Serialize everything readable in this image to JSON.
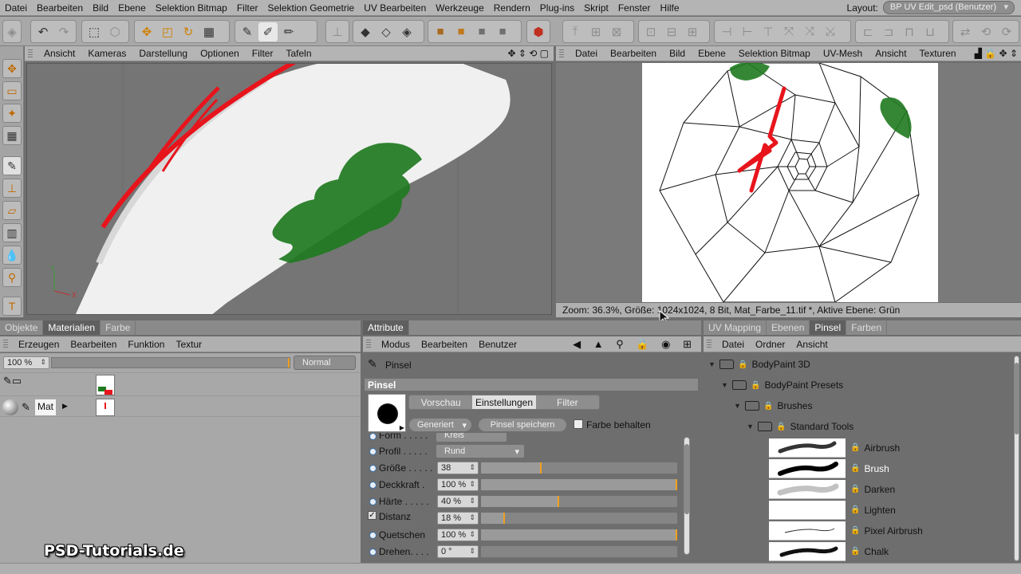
{
  "menubar": {
    "items": [
      "Datei",
      "Bearbeiten",
      "Bild",
      "Ebene",
      "Selektion Bitmap",
      "Filter",
      "Selektion Geometrie",
      "UV Bearbeiten",
      "Werkzeuge",
      "Rendern",
      "Plug-ins",
      "Skript",
      "Fenster",
      "Hilfe"
    ],
    "layout_label": "Layout:",
    "layout_value": "BP UV Edit_psd (Benutzer)"
  },
  "viewport": {
    "menu": [
      "Ansicht",
      "Kameras",
      "Darstellung",
      "Optionen",
      "Filter",
      "Tafeln"
    ]
  },
  "uv_editor": {
    "menu": [
      "Datei",
      "Bearbeiten",
      "Bild",
      "Ebene",
      "Selektion Bitmap",
      "UV-Mesh",
      "Ansicht",
      "Texturen"
    ],
    "status": "Zoom: 36.3%, Größe: 1024x1024, 8 Bit, Mat_Farbe_11.tif *, Aktive Ebene: Grün"
  },
  "materials_panel": {
    "tabs": [
      "Objekte",
      "Materialien",
      "Farbe"
    ],
    "active_tab": "Materialien",
    "menu": [
      "Erzeugen",
      "Bearbeiten",
      "Funktion",
      "Textur"
    ],
    "zoom_value": "100 %",
    "blend_mode": "Normal",
    "material_name": "Mat"
  },
  "attributes_panel": {
    "tab": "Attribute",
    "menu": [
      "Modus",
      "Bearbeiten",
      "Benutzer"
    ],
    "tool_title": "Pinsel",
    "section_title": "Pinsel",
    "subtabs": [
      "Vorschau",
      "Einstellungen",
      "Filter"
    ],
    "active_subtab": "Einstellungen",
    "preset_dropdown": "Generiert",
    "save_button": "Pinsel speichern",
    "keep_color_label": "Farbe behalten",
    "form_label": "Form . . . . .",
    "form_value": "Kreis",
    "params": [
      {
        "label": "Profil . . . . .",
        "value": "Rund",
        "type": "dropdown"
      },
      {
        "label": "Größe . . . . .",
        "value": "38",
        "type": "slider",
        "level": 0.31
      },
      {
        "label": "Deckkraft .",
        "value": "100 %",
        "type": "slider",
        "level": 1.0
      },
      {
        "label": "Härte . . . . .",
        "value": "40 %",
        "type": "slider",
        "level": 0.4
      },
      {
        "label": "Distanz",
        "value": "18 %",
        "type": "slider",
        "level": 0.12,
        "checkbox": true
      },
      {
        "label": "Quetschen",
        "value": "100 %",
        "type": "slider",
        "level": 1.0
      },
      {
        "label": "Drehen. . . .",
        "value": "0 °",
        "type": "slider",
        "level": 0.0
      }
    ]
  },
  "right_panel": {
    "tabs": [
      "UV Mapping",
      "Ebenen",
      "Pinsel",
      "Farben"
    ],
    "active_tab": "Pinsel",
    "menu": [
      "Datei",
      "Ordner",
      "Ansicht"
    ],
    "tree": [
      {
        "label": "BodyPaint 3D",
        "level": 0
      },
      {
        "label": "BodyPaint Presets",
        "level": 1
      },
      {
        "label": "Brushes",
        "level": 2
      },
      {
        "label": "Standard Tools",
        "level": 3
      }
    ],
    "brushes": [
      {
        "name": "Airbrush",
        "selected": false
      },
      {
        "name": "Brush",
        "selected": true
      },
      {
        "name": "Darken",
        "selected": false
      },
      {
        "name": "Lighten",
        "selected": false
      },
      {
        "name": "Pixel Airbrush",
        "selected": false
      },
      {
        "name": "Chalk",
        "selected": false
      }
    ]
  },
  "watermark": "PSD-Tutorials.de",
  "colors": {
    "paint_red": "#e8141c",
    "paint_green": "#1f7a1f",
    "accent_orange": "#f0a020"
  }
}
